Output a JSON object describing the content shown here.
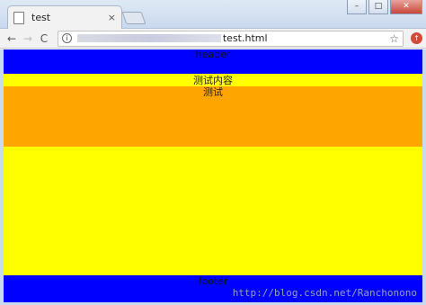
{
  "tab": {
    "title": "test",
    "close": "×"
  },
  "window": {
    "minimize": "–",
    "maximize": "□",
    "close": "✕"
  },
  "toolbar": {
    "back": "←",
    "forward": "→",
    "reload": "C",
    "info": "i",
    "url": "test.html",
    "star": "☆",
    "extension": "↑"
  },
  "page": {
    "header": "header",
    "content_title": "测试内容",
    "inner_text": "测试",
    "footer": "footer"
  },
  "watermark": "http://blog.csdn.net/Ranchonono",
  "colors": {
    "header_bg": "#0000ff",
    "content_bg": "#ffff00",
    "inner_bg": "#ffa500",
    "footer_bg": "#0000ff"
  },
  "icons": [
    "page-icon",
    "close-icon",
    "back-arrow-icon",
    "forward-arrow-icon",
    "reload-icon",
    "info-icon",
    "star-icon",
    "extension-icon"
  ]
}
